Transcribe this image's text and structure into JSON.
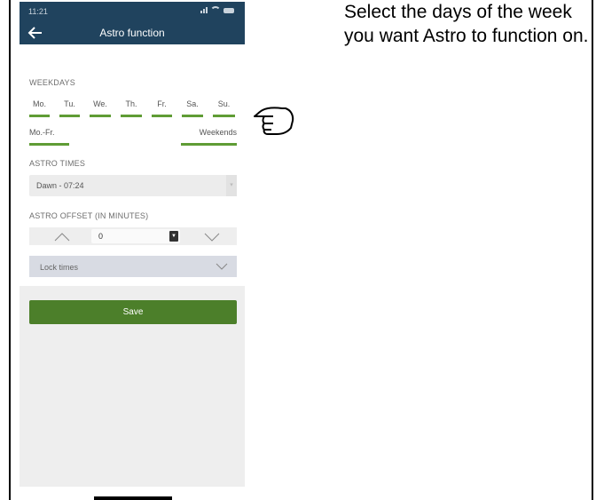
{
  "status_bar": {
    "time": "11:21"
  },
  "nav": {
    "title": "Astro function",
    "back_icon": "arrow-left-icon"
  },
  "weekdays": {
    "label": "WEEKDAYS",
    "days": [
      "Mo.",
      "Tu.",
      "We.",
      "Th.",
      "Fr.",
      "Sa.",
      "Su."
    ],
    "presets": {
      "weekdays": "Mo.-Fr.",
      "weekends": "Weekends"
    }
  },
  "astro_times": {
    "label": "ASTRO TIMES",
    "selected": "Dawn - 07:24"
  },
  "astro_offset": {
    "label": "ASTRO OFFSET (IN MINUTES)",
    "value": "0"
  },
  "lock_times": {
    "label": "Lock times"
  },
  "save": {
    "label": "Save"
  },
  "instruction": {
    "text": "Select the days of the week you want Astro to function on."
  },
  "colors": {
    "navbar": "#20435e",
    "accent_green": "#5f9c35",
    "save_button": "#4c7f2a"
  }
}
